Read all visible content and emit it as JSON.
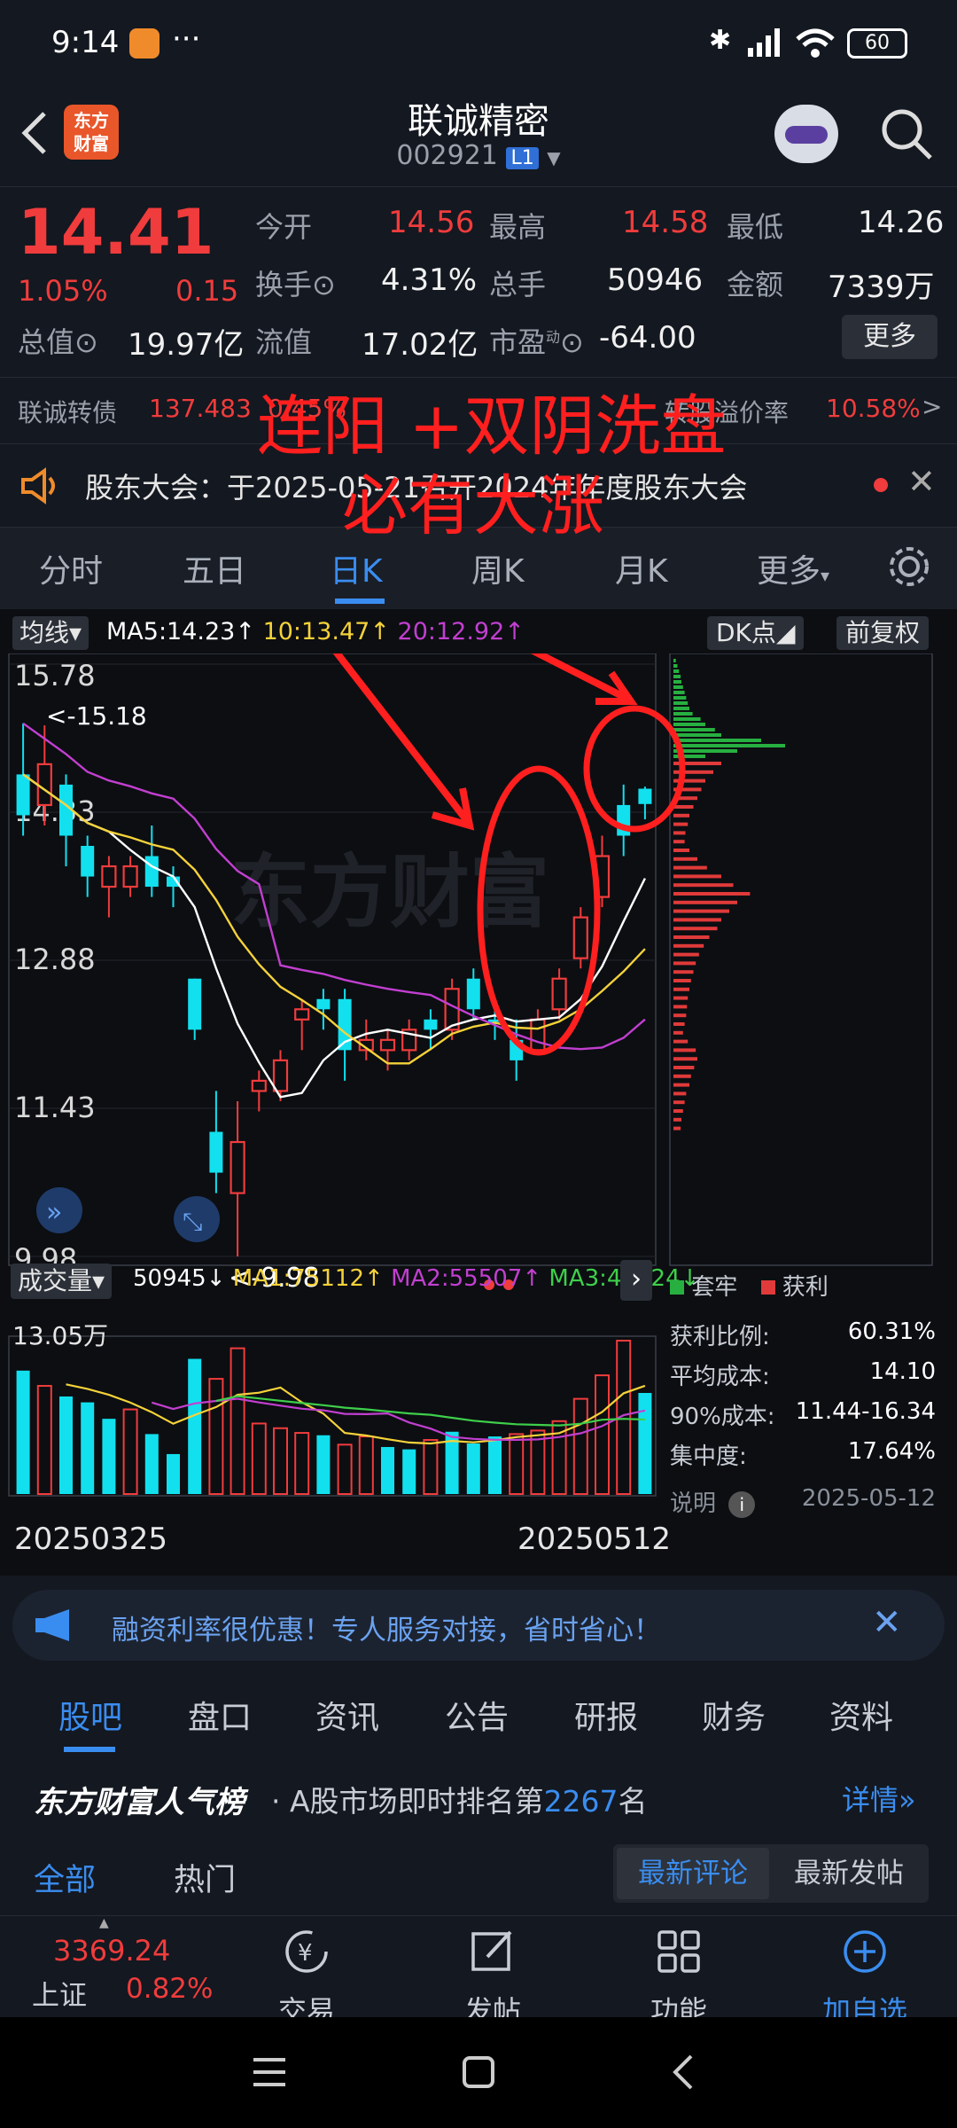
{
  "status": {
    "time": "9:14",
    "dots": "···",
    "battery": "60"
  },
  "header": {
    "title": "联诚精密",
    "code": "002921",
    "level": "L1",
    "logo_line1": "东方",
    "logo_line2": "财富"
  },
  "quote": {
    "price": "14.41",
    "change_pct": "1.05%",
    "change_amt": "0.15",
    "open_label": "今开",
    "open": "14.56",
    "high_label": "最高",
    "high": "14.58",
    "low_label": "最低",
    "low": "14.26",
    "turnover_label": "换手",
    "turnover": "4.31%",
    "volume_label": "总手",
    "volume": "50946",
    "amount_label": "金额",
    "amount": "7339万",
    "mktcap_label": "总值",
    "mktcap": "19.97亿",
    "float_label": "流值",
    "float": "17.02亿",
    "pe_label": "市盈",
    "pe_sup": "动",
    "pe": "-64.00",
    "more_btn": "更多"
  },
  "convertible": {
    "name": "联诚转债",
    "price": "137.483",
    "pct": "0.45%",
    "premium_label": "转股溢价率",
    "premium": "10.58%",
    "arrow": ">"
  },
  "notice": {
    "text": "股东大会：于2025-05-21召开2024年年度股东大会"
  },
  "tabs": [
    "分时",
    "五日",
    "日K",
    "周K",
    "月K",
    "更多"
  ],
  "chart": {
    "ma_selector": "均线",
    "ma5": "MA5:14.23",
    "ma10": "10:13.47",
    "ma20": "20:12.92",
    "dk_btn": "DK点",
    "adj_btn": "前复权",
    "y_labels": [
      "15.78",
      "14.33",
      "12.88",
      "11.43",
      "9.98"
    ],
    "high_marker": "<-15.18",
    "low_marker": "<-9.98",
    "vol_selector": "成交量",
    "vol_value": "50945",
    "vol_ma1": "MA1:75112",
    "vol_ma2": "MA2:55507",
    "vol_ma3": "MA3:46124",
    "vol_max": "13.05万",
    "date_start": "20250325",
    "date_end": "20250512",
    "watermark": "东方财富"
  },
  "annotation": {
    "line1": "连阳 +双阴洗盘",
    "line2": "必有大涨"
  },
  "chip": {
    "legend_trapped": "套牢",
    "legend_profit": "获利",
    "rows": [
      {
        "label": "获利比例:",
        "value": "60.31%"
      },
      {
        "label": "平均成本:",
        "value": "14.10"
      },
      {
        "label": "90%成本:",
        "value": "11.44-16.34"
      },
      {
        "label": "集中度:",
        "value": "17.64%"
      }
    ],
    "note_label": "说明",
    "date": "2025-05-12"
  },
  "ad": {
    "text": "融资利率很优惠！专人服务对接，省时省心！"
  },
  "bottom_tabs": [
    "股吧",
    "盘口",
    "资讯",
    "公告",
    "研报",
    "财务",
    "资料"
  ],
  "rank": {
    "brand": "东方财富人气榜",
    "prefix": "A股市场即时排名第",
    "number": "2267",
    "suffix": "名",
    "detail": "详情"
  },
  "filters": {
    "left": [
      "全部",
      "热门"
    ],
    "right": [
      "最新评论",
      "最新发帖"
    ]
  },
  "navbar": {
    "index_value": "3369.24",
    "index_name": "上证",
    "index_pct": "0.82%",
    "items": [
      "交易",
      "发帖",
      "功能",
      "加自选"
    ]
  },
  "chart_data": {
    "type": "candlestick",
    "ylim": [
      9.98,
      15.78
    ],
    "candles": [
      {
        "o": 14.3,
        "c": 14.7,
        "h": 15.2,
        "l": 14.1,
        "up": false
      },
      {
        "o": 14.8,
        "c": 14.4,
        "h": 15.18,
        "l": 14.2,
        "up": true
      },
      {
        "o": 14.6,
        "c": 14.1,
        "h": 14.7,
        "l": 13.8,
        "up": false
      },
      {
        "o": 14.0,
        "c": 13.7,
        "h": 14.1,
        "l": 13.5,
        "up": false
      },
      {
        "o": 13.6,
        "c": 13.8,
        "h": 13.9,
        "l": 13.3,
        "up": true
      },
      {
        "o": 13.6,
        "c": 13.8,
        "h": 13.9,
        "l": 13.5,
        "up": true
      },
      {
        "o": 13.9,
        "c": 13.6,
        "h": 14.2,
        "l": 13.5,
        "up": false
      },
      {
        "o": 13.7,
        "c": 13.6,
        "h": 13.8,
        "l": 13.4,
        "up": false
      },
      {
        "o": 12.7,
        "c": 12.2,
        "h": 12.7,
        "l": 12.1,
        "up": false
      },
      {
        "o": 11.2,
        "c": 10.8,
        "h": 11.6,
        "l": 10.6,
        "up": false
      },
      {
        "o": 10.6,
        "c": 11.1,
        "h": 11.5,
        "l": 9.98,
        "up": true
      },
      {
        "o": 11.6,
        "c": 11.7,
        "h": 11.8,
        "l": 11.4,
        "up": true
      },
      {
        "o": 11.6,
        "c": 11.9,
        "h": 12.0,
        "l": 11.5,
        "up": true
      },
      {
        "o": 12.3,
        "c": 12.4,
        "h": 12.5,
        "l": 12.0,
        "up": true
      },
      {
        "o": 12.5,
        "c": 12.4,
        "h": 12.6,
        "l": 12.2,
        "up": false
      },
      {
        "o": 12.5,
        "c": 12.0,
        "h": 12.6,
        "l": 11.7,
        "up": false
      },
      {
        "o": 12.0,
        "c": 12.1,
        "h": 12.3,
        "l": 11.9,
        "up": true
      },
      {
        "o": 12.0,
        "c": 12.1,
        "h": 12.2,
        "l": 11.8,
        "up": true
      },
      {
        "o": 12.0,
        "c": 12.2,
        "h": 12.3,
        "l": 11.9,
        "up": true
      },
      {
        "o": 12.3,
        "c": 12.2,
        "h": 12.4,
        "l": 12.0,
        "up": false
      },
      {
        "o": 12.2,
        "c": 12.6,
        "h": 12.7,
        "l": 12.1,
        "up": true
      },
      {
        "o": 12.7,
        "c": 12.4,
        "h": 12.8,
        "l": 12.3,
        "up": false
      },
      {
        "o": 12.3,
        "c": 12.3,
        "h": 12.4,
        "l": 12.1,
        "up": false
      },
      {
        "o": 12.1,
        "c": 11.9,
        "h": 12.3,
        "l": 11.7,
        "up": false
      },
      {
        "o": 12.0,
        "c": 12.3,
        "h": 12.4,
        "l": 12.0,
        "up": true
      },
      {
        "o": 12.4,
        "c": 12.7,
        "h": 12.8,
        "l": 12.3,
        "up": true
      },
      {
        "o": 12.9,
        "c": 13.3,
        "h": 13.4,
        "l": 12.8,
        "up": true
      },
      {
        "o": 13.5,
        "c": 13.9,
        "h": 14.1,
        "l": 13.4,
        "up": true
      },
      {
        "o": 14.4,
        "c": 14.1,
        "h": 14.6,
        "l": 13.9,
        "up": false
      },
      {
        "o": 14.56,
        "c": 14.41,
        "h": 14.58,
        "l": 14.26,
        "up": false
      }
    ],
    "volume": [
      {
        "v": 10.5,
        "up": false
      },
      {
        "v": 9.2,
        "up": true
      },
      {
        "v": 8.3,
        "up": false
      },
      {
        "v": 7.8,
        "up": false
      },
      {
        "v": 6.4,
        "up": false
      },
      {
        "v": 7.2,
        "up": true
      },
      {
        "v": 5.1,
        "up": false
      },
      {
        "v": 3.4,
        "up": false
      },
      {
        "v": 11.5,
        "up": false
      },
      {
        "v": 9.8,
        "up": true
      },
      {
        "v": 12.4,
        "up": true
      },
      {
        "v": 6.0,
        "up": true
      },
      {
        "v": 5.6,
        "up": true
      },
      {
        "v": 5.2,
        "up": true
      },
      {
        "v": 5.0,
        "up": false
      },
      {
        "v": 4.2,
        "up": true
      },
      {
        "v": 4.9,
        "up": true
      },
      {
        "v": 4.0,
        "up": false
      },
      {
        "v": 3.8,
        "up": false
      },
      {
        "v": 4.6,
        "up": true
      },
      {
        "v": 5.3,
        "up": false
      },
      {
        "v": 4.3,
        "up": false
      },
      {
        "v": 4.9,
        "up": false
      },
      {
        "v": 5.1,
        "up": true
      },
      {
        "v": 5.4,
        "up": true
      },
      {
        "v": 6.2,
        "up": true
      },
      {
        "v": 8.1,
        "up": true
      },
      {
        "v": 10.1,
        "up": true
      },
      {
        "v": 13.05,
        "up": true
      },
      {
        "v": 8.6,
        "up": false
      }
    ],
    "chip_trapped": [
      3,
      5,
      7,
      9,
      10,
      12,
      14,
      16,
      18,
      20,
      24,
      34,
      40,
      52,
      60,
      110,
      140,
      80,
      40
    ],
    "chip_profit": [
      60,
      50,
      40,
      35,
      30,
      25,
      20,
      18,
      15,
      14,
      20,
      30,
      42,
      60,
      75,
      96,
      80,
      70,
      60,
      55,
      45,
      38,
      32,
      28,
      25,
      22,
      20,
      18,
      17,
      16,
      14,
      12,
      18,
      28,
      30,
      26,
      22,
      20,
      16,
      14,
      12,
      10,
      9
    ]
  }
}
